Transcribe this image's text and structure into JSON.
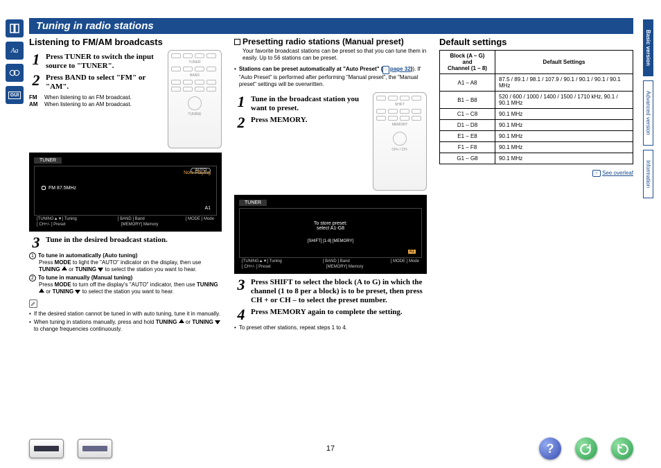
{
  "title": "Tuning in radio stations",
  "col1": {
    "heading": "Listening to FM/AM broadcasts",
    "step1": "Press TUNER to switch the input source to \"TUNER\".",
    "step2": "Press BAND to select \"FM\" or \"AM\".",
    "fm_lbl": "FM",
    "fm_txt": "When listening to an FM broadcast.",
    "am_lbl": "AM",
    "am_txt": "When listening to an AM broadcast.",
    "scr_tuner": "TUNER",
    "scr_np": "Now Playing",
    "scr_auto": "AUTO",
    "scr_freq": "FM 87.5MHz",
    "scr_a1": "A1",
    "scr_ftrA": "[TUNING▲▼]  Tuning",
    "scr_ftrB": "[ BAND ]  Band",
    "scr_ftrC": "[ MODE ]  Mode",
    "scr_ftrD": "[  CH+/-  ]  Preset",
    "scr_ftrE": "[MEMORY]  Memory",
    "step3": "Tune in the desired broadcast station.",
    "auto_h": "To tune in automatically (Auto tuning)",
    "auto_txt1": "Press ",
    "auto_txt2": " to light the \"AUTO\" indicator on the display, then use ",
    "auto_txt3": " or ",
    "auto_txt4": " to select the station you want to hear.",
    "man_h": "To tune in manually (Manual tuning)",
    "man_txt1": "Press ",
    "man_txt2": " to turn off the display's \"AUTO\" indicator, then use ",
    "man_txt3": " or ",
    "man_txt4": " to select the station you want to hear.",
    "k_mode": "MODE",
    "k_tuning": "TUNING",
    "note1": "If the desired station cannot be tuned in with auto tuning, tune it in manually.",
    "note2a": "When tuning in stations manually, press and hold ",
    "note2b": " or ",
    "note2c": " to change frequencies continuously."
  },
  "col2": {
    "heading": "Presetting radio stations (Manual preset)",
    "intro": "Your favorite broadcast stations can be preset so that you can tune them in easily. Up to 56 stations can be preset.",
    "bullet_a": "Stations can be preset automatically at \"Auto Preset\" (",
    "bullet_link": "page 32",
    "bullet_b": "). If \"Auto Preset\" is performed after performing \"Manual preset\", the \"Manual preset\" settings will be overwritten.",
    "step1": "Tune in the broadcast station you want to preset.",
    "step2": "Press MEMORY.",
    "scr_txt1": "To store preset:",
    "scr_txt2": "select  A1-G8",
    "scr_row": "[SHIFT]        [1-8]      [MEMORY]",
    "step3": "Press SHIFT to select the block (A to G) in which the channel (1 to 8 per a block) is to be preset, then press CH + or CH – to select the preset number.",
    "step4": "Press MEMORY again to complete the setting.",
    "repeat": "To preset other stations, repeat steps 1 to 4."
  },
  "col3": {
    "heading": "Default settings",
    "th1": "Block (A – G)\nand\nChannel (1 – 8)",
    "th2": "Default Settings",
    "rows": [
      {
        "b": "A1 – A8",
        "v": "87.5 / 89.1 / 98.1 / 107.9 / 90.1 / 90.1 / 90.1 / 90.1 MHz"
      },
      {
        "b": "B1 – B8",
        "v": "520 / 600 / 1000 / 1400 / 1500 / 1710 kHz, 90.1 / 90.1 MHz"
      },
      {
        "b": "C1 – C8",
        "v": "90.1 MHz"
      },
      {
        "b": "D1 – D8",
        "v": "90.1 MHz"
      },
      {
        "b": "E1 – E8",
        "v": "90.1 MHz"
      },
      {
        "b": "F1 – F8",
        "v": "90.1 MHz"
      },
      {
        "b": "G1 – G8",
        "v": "90.1 MHz"
      }
    ],
    "overleaf": "See overleaf"
  },
  "tabs": {
    "basic": "Basic version",
    "advanced": "Advanced version",
    "info": "Information"
  },
  "pagenum": "17"
}
